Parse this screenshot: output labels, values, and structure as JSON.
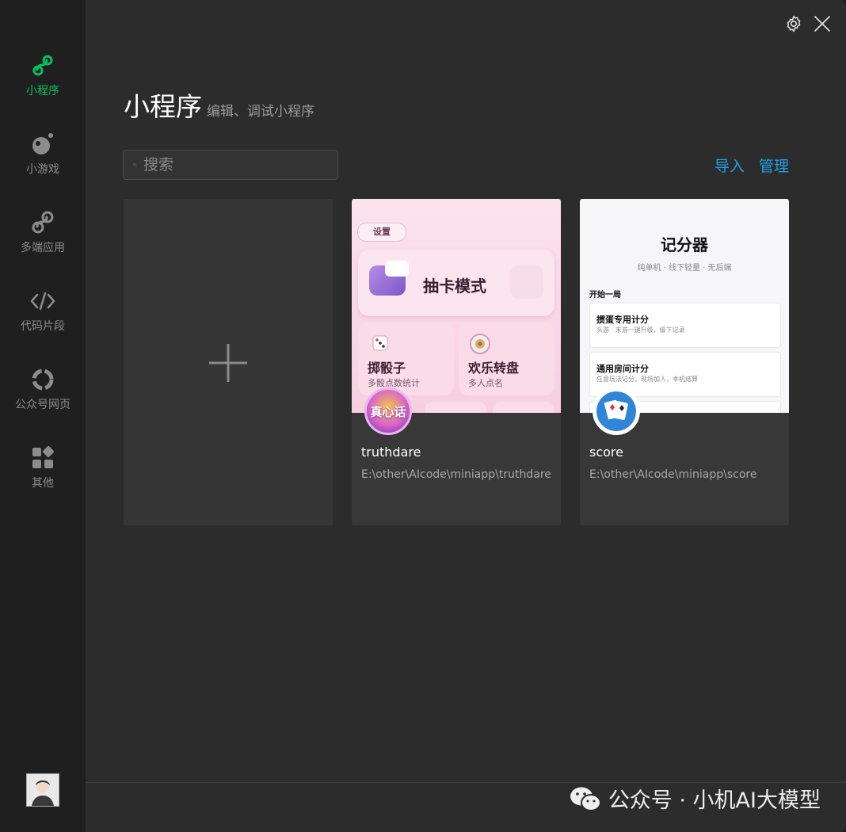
{
  "sidebar": {
    "items": [
      {
        "label": "小程序",
        "icon": "mini-program-icon",
        "active": true
      },
      {
        "label": "小游戏",
        "icon": "mini-game-icon",
        "active": false
      },
      {
        "label": "多端应用",
        "icon": "multi-platform-icon",
        "active": false
      },
      {
        "label": "代码片段",
        "icon": "code-snippet-icon",
        "active": false
      },
      {
        "label": "公众号网页",
        "icon": "official-account-icon",
        "active": false
      },
      {
        "label": "其他",
        "icon": "apps-grid-icon",
        "active": false
      }
    ],
    "accent_color": "#07c160"
  },
  "header": {
    "title": "小程序",
    "subtitle": "编辑、调试小程序"
  },
  "search": {
    "placeholder": "搜索"
  },
  "actions": {
    "import_label": "导入",
    "manage_label": "管理",
    "link_color": "#1aa0e8"
  },
  "projects": [
    {
      "name": "truthdare",
      "path": "E:\\other\\AIcode\\miniapp\\truthdare",
      "icon_text": "真心话",
      "preview": {
        "settings": "设置",
        "hero": "抽卡模式",
        "cell1_title": "掷骰子",
        "cell1_sub": "多骰点数统计",
        "cell2_title": "欢乐转盘",
        "cell2_sub": "多人点名"
      }
    },
    {
      "name": "score",
      "path": "E:\\other\\AIcode\\miniapp\\score",
      "preview": {
        "title": "记分器",
        "subtitle": "纯单机 · 线下轻量 · 无后端",
        "section": "开始一局",
        "row1_title": "掼蛋专用计分",
        "row1_sub": "头游 · 末游一键升级，级下记录",
        "row2_title": "通用房间计分",
        "row2_sub": "任意玩法记分，现场加人，本机结算"
      }
    }
  ],
  "watermark": {
    "text": "公众号 · 小机AI大模型"
  }
}
